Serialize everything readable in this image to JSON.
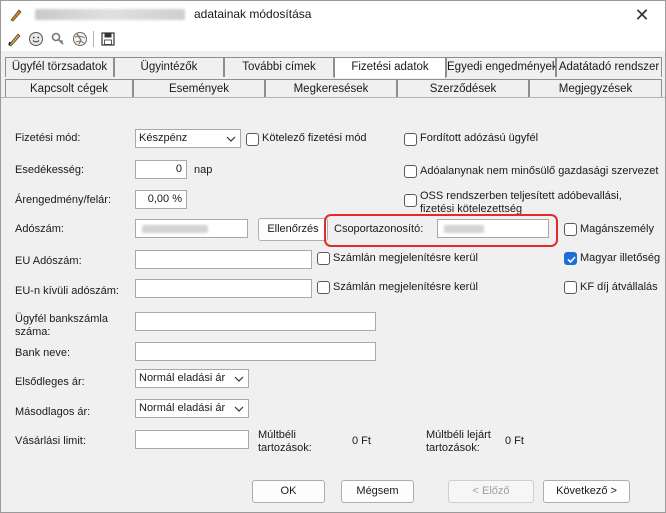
{
  "window": {
    "title": "adatainak módosítása",
    "close_label": "✕"
  },
  "toolbar": {
    "icons": [
      "pen-icon",
      "smiley-icon",
      "key-icon",
      "globe-icon",
      "save-icon"
    ]
  },
  "tabs": {
    "row1": [
      "Ügyfél törzsadatok",
      "Ügyintézők",
      "További címek",
      "Fizetési adatok",
      "Egyedi engedmények",
      "Adatátadó rendszer"
    ],
    "row2": [
      "Kapcsolt cégek",
      "Események",
      "Megkeresések",
      "Szerződések",
      "Megjegyzések"
    ],
    "active": "Fizetési adatok"
  },
  "form": {
    "payment_method_label": "Fizetési mód:",
    "payment_method_value": "Készpénz",
    "mandatory_payment_label": "Kötelező fizetési mód",
    "reverse_vat_label": "Fordított adózású ügyfél",
    "due_label": "Esedékesség:",
    "due_value": "0",
    "due_unit": "nap",
    "non_entity_label": "Adóalanynak nem minősülő gazdasági szervezet",
    "discount_label": "Árengedmény/felár:",
    "discount_value": "0,00 %",
    "oss_label": "OSS rendszerben teljesített adóbevallási, fizetési kötelezettség",
    "tax_number_label": "Adószám:",
    "check_button": "Ellenőrzés",
    "group_id_label": "Csoportazonosító:",
    "private_person_label": "Magánszemély",
    "eu_tax_label": "EU Adószám:",
    "show_on_invoice_label_1": "Számlán megjelenítésre kerül",
    "hungarian_resident_label": "Magyar illetőség",
    "non_eu_tax_label": "EU-n kívüli adószám:",
    "show_on_invoice_label_2": "Számlán megjelenítésre kerül",
    "kf_fee_label": "KF díj átvállalás",
    "bank_account_label_1": "Ügyfél bankszámla",
    "bank_account_label_2": "száma:",
    "bank_name_label": "Bank neve:",
    "primary_price_label": "Elsődleges ár:",
    "primary_price_value": "Normál eladási ár",
    "secondary_price_label": "Másodlagos ár:",
    "secondary_price_value": "Normál eladási ár",
    "purchase_limit_label": "Vásárlási limit:",
    "past_receivables_label_1": "Múltbéli",
    "past_receivables_label_2": "tartozások:",
    "past_receivables_value": "0 Ft",
    "past_overdue_label_1": "Múltbéli lejárt",
    "past_overdue_label_2": "tartozások:",
    "past_overdue_value": "0 Ft",
    "checkboxes": {
      "mandatory_payment": false,
      "reverse_vat": false,
      "non_entity": false,
      "oss": false,
      "private_person": false,
      "eu_invoice": false,
      "hungarian_resident": true,
      "non_eu_invoice": false,
      "kf_fee": false
    }
  },
  "buttons": {
    "ok": "OK",
    "cancel": "Mégsem",
    "prev": "< Előző",
    "next": "Következő >"
  },
  "colors": {
    "highlight": "#e22b2b",
    "checkbox_checked": "#1b6fd8"
  }
}
